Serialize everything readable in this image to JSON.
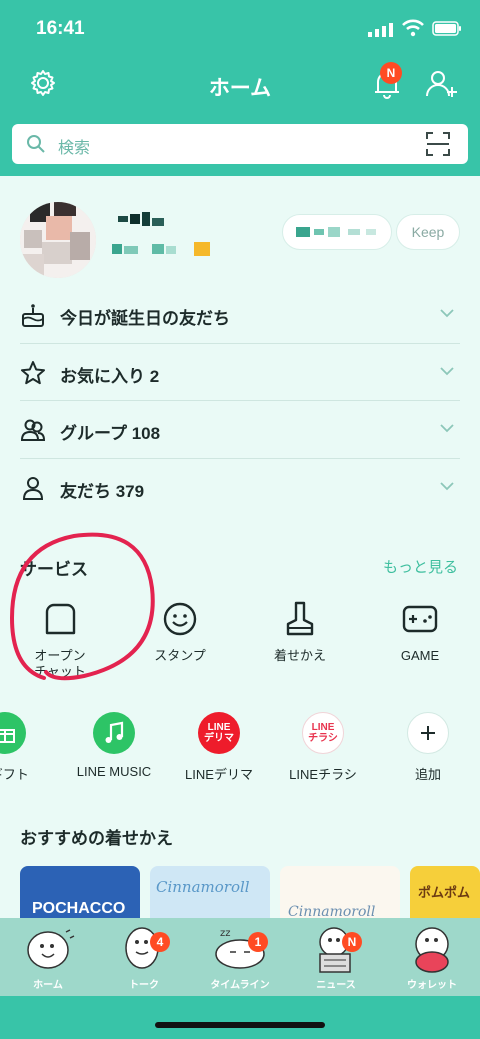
{
  "status_bar": {
    "time": "16:41"
  },
  "header": {
    "title": "ホーム",
    "notification_badge": "N"
  },
  "search": {
    "placeholder": "検索"
  },
  "profile": {
    "keep_label": "Keep"
  },
  "rows": [
    {
      "label": "今日が誕生日の友だち",
      "icon": "cake-icon"
    },
    {
      "label": "お気に入り 2",
      "icon": "star-icon"
    },
    {
      "label": "グループ 108",
      "icon": "group-icon"
    },
    {
      "label": "友だち 379",
      "icon": "person-icon"
    }
  ],
  "services": {
    "title": "サービス",
    "more": "もっと見る",
    "items": [
      {
        "label": "オープン\nチャット",
        "icon": "open-chat-icon"
      },
      {
        "label": "スタンプ",
        "icon": "smile-icon"
      },
      {
        "label": "着せかえ",
        "icon": "brush-icon"
      },
      {
        "label": "GAME",
        "icon": "gamepad-icon"
      }
    ]
  },
  "apps": [
    {
      "label": "Eギフト",
      "icon": "gift-icon"
    },
    {
      "label": "LINE MUSIC",
      "icon": "music-icon"
    },
    {
      "label": "LINEデリマ",
      "badge": "LINE\nデリマ"
    },
    {
      "label": "LINEチラシ",
      "badge": "LINE\nチラシ"
    },
    {
      "label": "追加",
      "icon": "plus-icon"
    }
  ],
  "recommended": {
    "title": "おすすめの着せかえ",
    "items": [
      "POCHACCO",
      "Cinnamoroll",
      "Cinnamoroll",
      "ポムポム"
    ]
  },
  "tabbar": [
    {
      "label": "ホーム",
      "count": ""
    },
    {
      "label": "トーク",
      "count": "4"
    },
    {
      "label": "タイムライン",
      "count": "1"
    },
    {
      "label": "ニュース",
      "count": "N"
    },
    {
      "label": "ウォレット",
      "count": ""
    }
  ],
  "colors": {
    "brand": "#38c4a8",
    "badge": "#ff4b23",
    "background": "#eafaf6"
  }
}
